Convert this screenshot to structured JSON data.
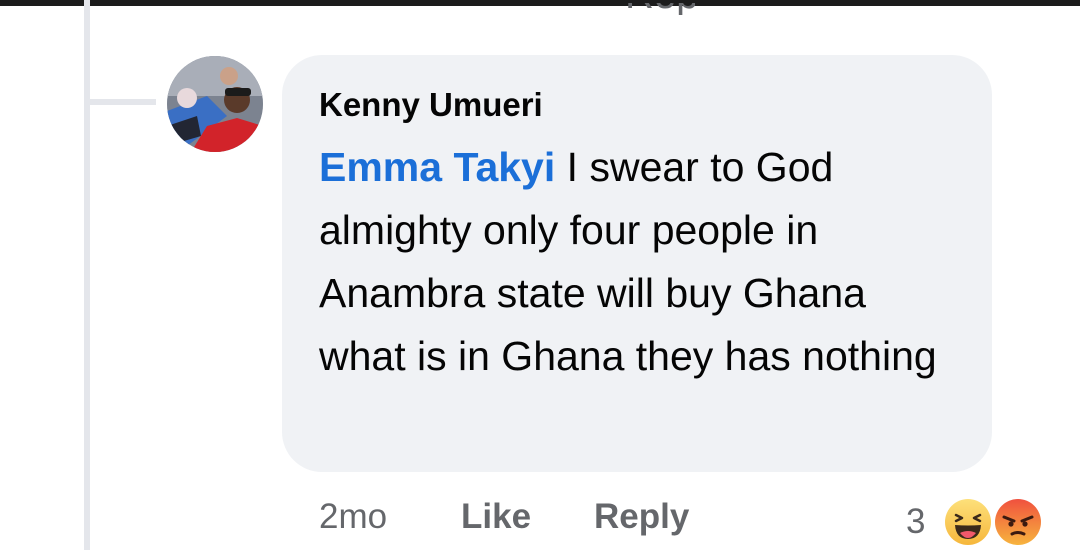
{
  "previous_reply_fragment": "Reply",
  "comment": {
    "author": "Kenny Umueri",
    "mention": "Emma Takyi",
    "text": "I swear to God almighty only four people in Anambra state will buy Ghana what is in Ghana they has nothing",
    "time": "2mo",
    "like_label": "Like",
    "reply_label": "Reply",
    "reaction_count": "3",
    "reactions": [
      "haha-icon",
      "angry-icon"
    ]
  },
  "colors": {
    "bubble_bg": "#f0f2f5",
    "mention": "#1b6fd8",
    "meta_text": "#65676b",
    "thread_line": "#e4e6eb"
  }
}
